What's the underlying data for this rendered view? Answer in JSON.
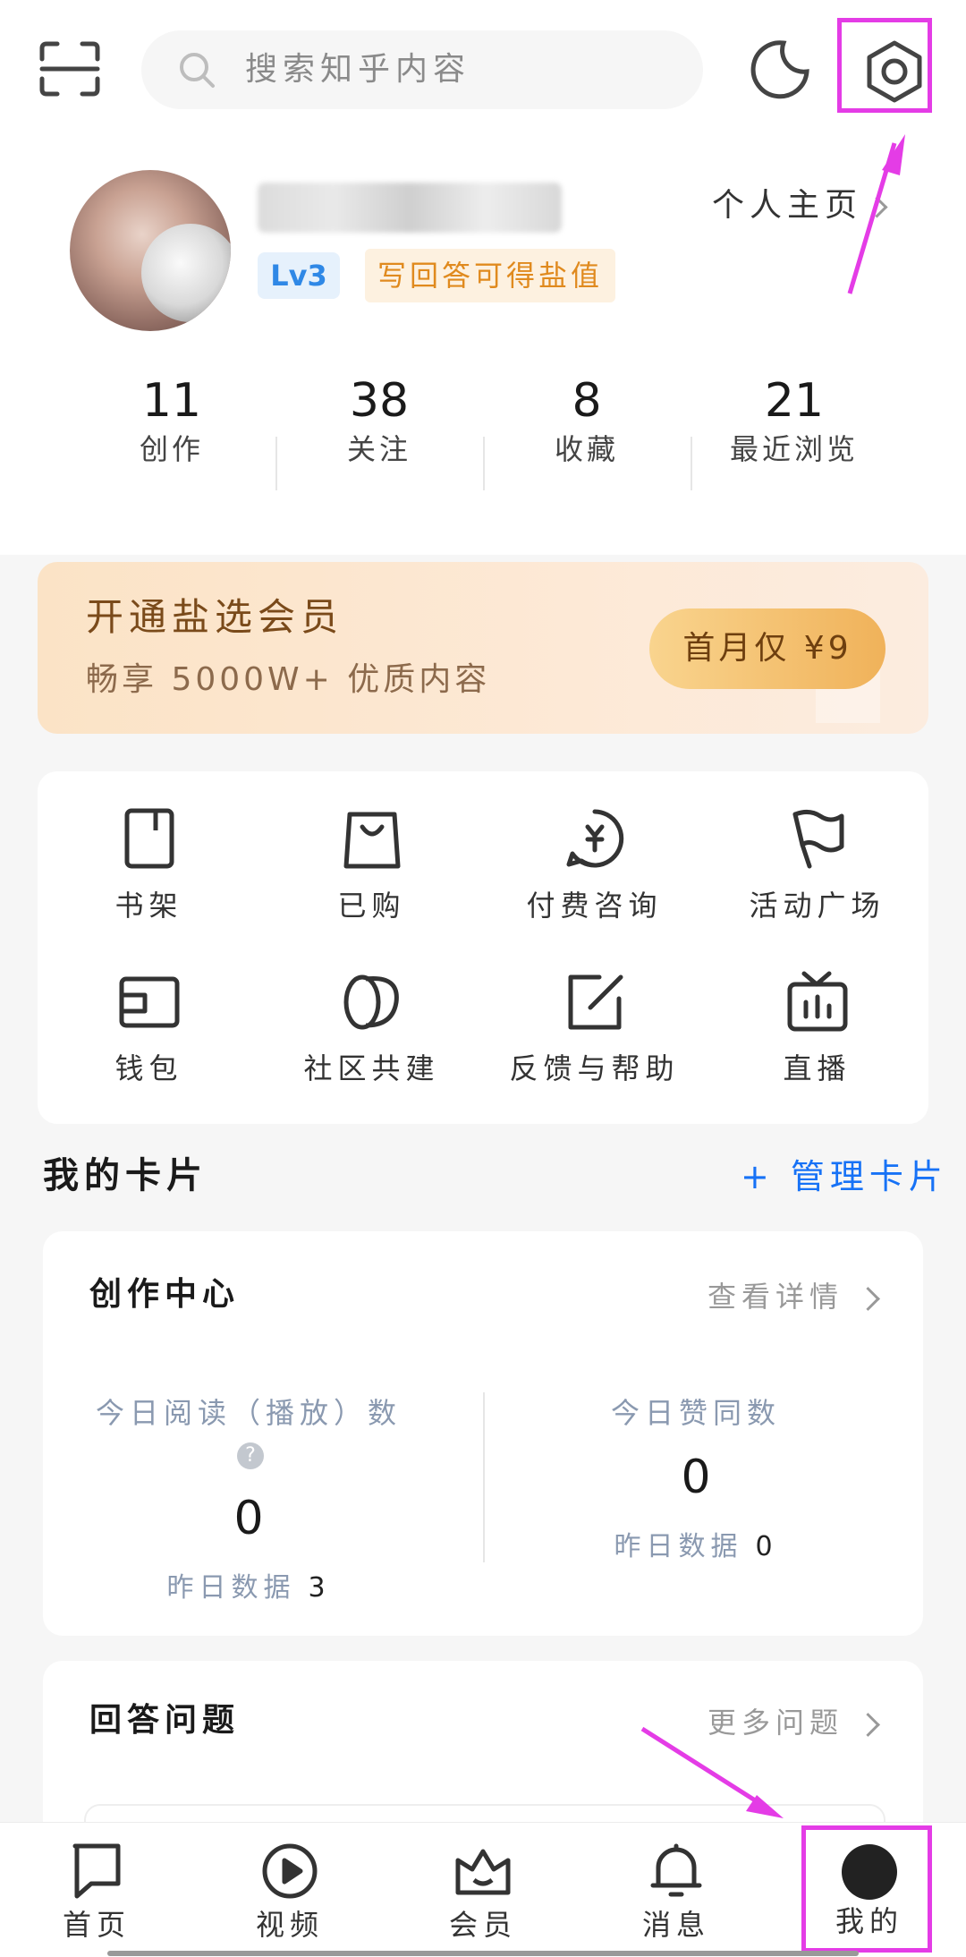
{
  "header": {
    "search_placeholder": "搜索知乎内容",
    "scan_icon": "scan-icon",
    "theme_icon": "moon-icon",
    "settings_icon": "gear-icon"
  },
  "profile": {
    "homepage_link": "个人主页",
    "level_badge": "Lv3",
    "tip": "写回答可得盐值",
    "stats": [
      {
        "value": "11",
        "label": "创作"
      },
      {
        "value": "38",
        "label": "关注"
      },
      {
        "value": "8",
        "label": "收藏"
      },
      {
        "value": "21",
        "label": "最近浏览"
      }
    ]
  },
  "vip": {
    "title": "开通盐选会员",
    "subtitle": "畅享 5000W+ 优质内容",
    "button": "首月仅 ¥9"
  },
  "grid": [
    {
      "label": "书架",
      "icon": "bookshelf-icon"
    },
    {
      "label": "已购",
      "icon": "bag-icon"
    },
    {
      "label": "付费咨询",
      "icon": "paid-consult-icon"
    },
    {
      "label": "活动广场",
      "icon": "flag-icon"
    },
    {
      "label": "钱包",
      "icon": "wallet-icon"
    },
    {
      "label": "社区共建",
      "icon": "community-icon"
    },
    {
      "label": "反馈与帮助",
      "icon": "feedback-icon"
    },
    {
      "label": "直播",
      "icon": "tv-icon"
    }
  ],
  "cards": {
    "title": "我的卡片",
    "manage": "+ 管理卡片",
    "creation": {
      "title": "创作中心",
      "more": "查看详情",
      "reads_label": "今日阅读（播放）数",
      "reads_value": "0",
      "reads_yesterday_label": "昨日数据",
      "reads_yesterday_value": "3",
      "likes_label": "今日赞同数",
      "likes_value": "0",
      "likes_yesterday_label": "昨日数据",
      "likes_yesterday_value": "0"
    },
    "answer": {
      "title": "回答问题",
      "more": "更多问题"
    }
  },
  "tabbar": [
    {
      "label": "首页",
      "icon": "home-icon"
    },
    {
      "label": "视频",
      "icon": "play-icon"
    },
    {
      "label": "会员",
      "icon": "crown-icon"
    },
    {
      "label": "消息",
      "icon": "bell-icon"
    },
    {
      "label": "我的",
      "icon": "avatar-icon"
    }
  ],
  "colors": {
    "accent_blue": "#1772f6",
    "highlight_magenta": "#e43ce6",
    "vip_gold": "#f0b25a"
  }
}
